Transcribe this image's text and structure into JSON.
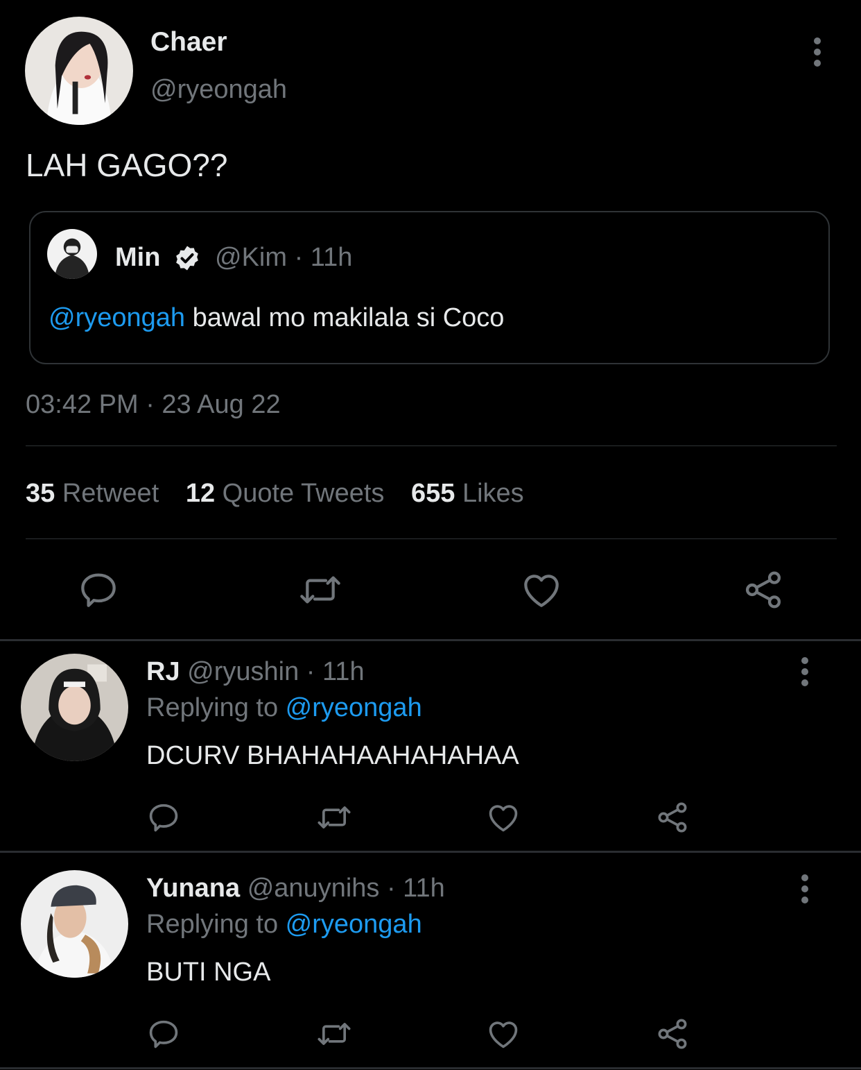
{
  "main_tweet": {
    "author_name": "Chaer",
    "author_handle": "@ryeongah",
    "text": "LAH GAGO??",
    "quoted": {
      "author_name": "Min",
      "author_handle": "@Kim",
      "time": "· 11h",
      "mention": "@ryeongah",
      "text": " bawal mo makilala si Coco"
    },
    "timestamp": "03:42 PM · 23 Aug 22",
    "stats": {
      "retweets_count": "35",
      "retweets_label": "Retweet",
      "quotes_count": "12",
      "quotes_label": "Quote Tweets",
      "likes_count": "655",
      "likes_label": "Likes"
    }
  },
  "replies": [
    {
      "author_name": "RJ",
      "author_handle": "@ryushin",
      "time": "· 11h",
      "replying_prefix": "Replying to ",
      "replying_to": "@ryeongah",
      "text": "DCURV BHAHAHAAHAHAHAA"
    },
    {
      "author_name": "Yunana",
      "author_handle": "@anuynihs",
      "time": "· 11h",
      "replying_prefix": "Replying to ",
      "replying_to": "@ryeongah",
      "text": "BUTI NGA"
    }
  ],
  "colors": {
    "background": "#000000",
    "text": "#e7e9ea",
    "muted": "#71767b",
    "link": "#1d9bf0",
    "border": "#2f3336"
  },
  "icons": [
    "more-vertical-icon",
    "verified-badge-icon",
    "reply-icon",
    "retweet-icon",
    "like-icon",
    "share-icon"
  ]
}
